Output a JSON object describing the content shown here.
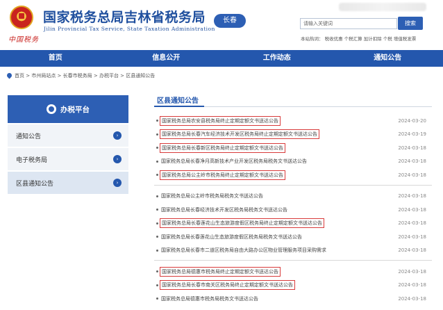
{
  "header": {
    "title_cn": "国家税务总局吉林省税务局",
    "title_en": "Jilin Provincial Tax Service, State Taxation Administration",
    "city_badge": "长春",
    "seal_text": "中国税务",
    "search_placeholder": "请输入关键词",
    "search_button": "搜索",
    "hot_words": "本站热词：  税收优惠  个税汇算  加计扣除  个税  增值税发票"
  },
  "nav": [
    "首页",
    "信息公开",
    "工作动态",
    "通知公告"
  ],
  "breadcrumb": "首页 > 市州局站点 > 长春市税务局 > 办税平台 > 区县通知公告",
  "sidebar": {
    "head": "办税平台",
    "items": [
      "通知公告",
      "电子税务局",
      "区县通知公告"
    ]
  },
  "main": {
    "title": "区县通知公告",
    "rows": [
      {
        "title": "国家税务总局农安县税务局终止定期定额文书送达公告",
        "date": "2024-03-20",
        "hl": true
      },
      {
        "title": "国家税务总局长春汽车经济技术开发区税务局终止定期定额文书送达公告",
        "date": "2024-03-19",
        "hl": true
      },
      {
        "title": "国家税务总局长春新区税务局终止定期定额文书送达公告",
        "date": "2024-03-18",
        "hl": true
      },
      {
        "title": "国家税务总局长春净月高新技术产业开发区税务局税务文书送达公告",
        "date": "2024-03-18",
        "hl": false
      },
      {
        "title": "国家税务总局公主岭市税务局终止定期定额文书送达公告",
        "date": "2024-03-18",
        "hl": true
      },
      {
        "sep": true
      },
      {
        "title": "国家税务总局公主岭市税务局税务文书送达公告",
        "date": "2024-03-18",
        "hl": false
      },
      {
        "title": "国家税务总局长春经济技术开发区税务局税务文书送达公告",
        "date": "2024-03-18",
        "hl": false
      },
      {
        "title": "国家税务总局长春莲花山生态旅游度假区税务局终止定期定额文书送达公告",
        "date": "2024-03-18",
        "hl": true
      },
      {
        "title": "国家税务总局长春莲花山生态旅游度假区税务局税务文书送达公告",
        "date": "2024-03-18",
        "hl": false
      },
      {
        "title": "国家税务总局长春市二道区税务局自由大路办公区物业管理服务项目采购需求",
        "date": "2024-03-18",
        "hl": false
      },
      {
        "sep": true
      },
      {
        "title": "国家税务总局德惠市税务局终止定期定额文书送达公告",
        "date": "2024-03-18",
        "hl": true
      },
      {
        "title": "国家税务总局长春市南关区税务局终止定期定额文书送达公告",
        "date": "2024-03-18",
        "hl": true
      },
      {
        "title": "国家税务总局德惠市税务局税务文书送达公告",
        "date": "2024-03-18",
        "hl": false
      }
    ]
  },
  "colors": {
    "brand": "#2457ad",
    "highlight": "#d83a3a"
  }
}
